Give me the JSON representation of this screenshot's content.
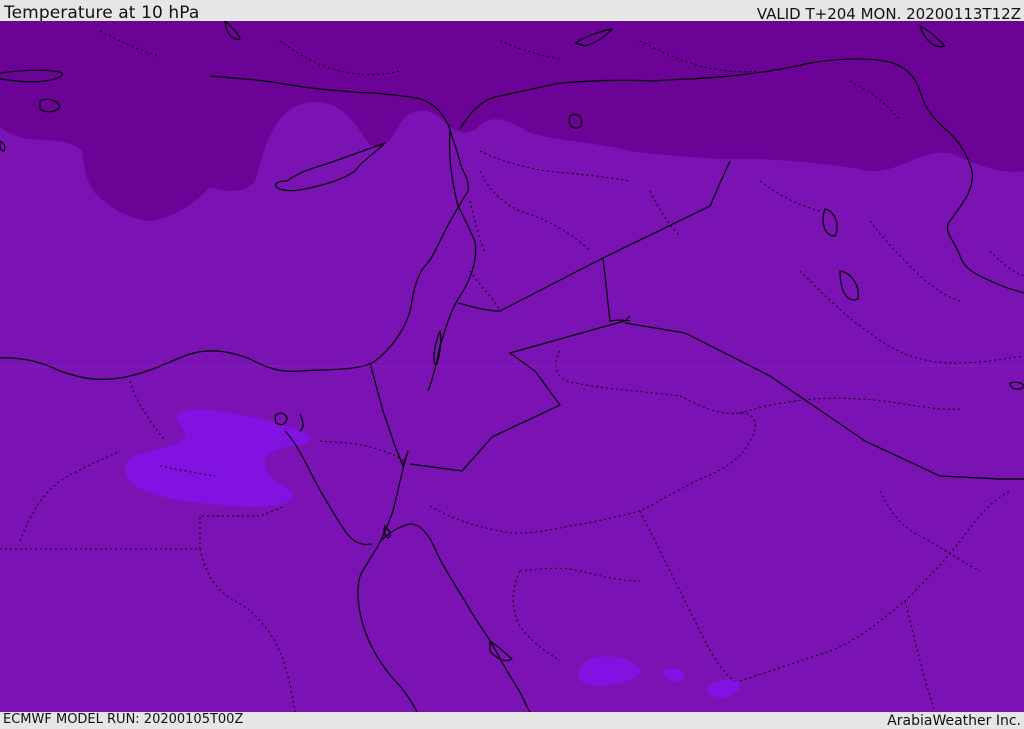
{
  "header": {
    "title": "Temperature at 10 hPa",
    "valid": "VALID T+204 MON. 20200113T12Z"
  },
  "footer": {
    "model_run": "ECMWF MODEL RUN: 20200105T00Z",
    "credit": "ArabiaWeather Inc."
  },
  "colors": {
    "base_field": "#7a12b4",
    "cold_field": "#6a0396",
    "warm_patch": "#8212e2",
    "borders": "#000000"
  }
}
